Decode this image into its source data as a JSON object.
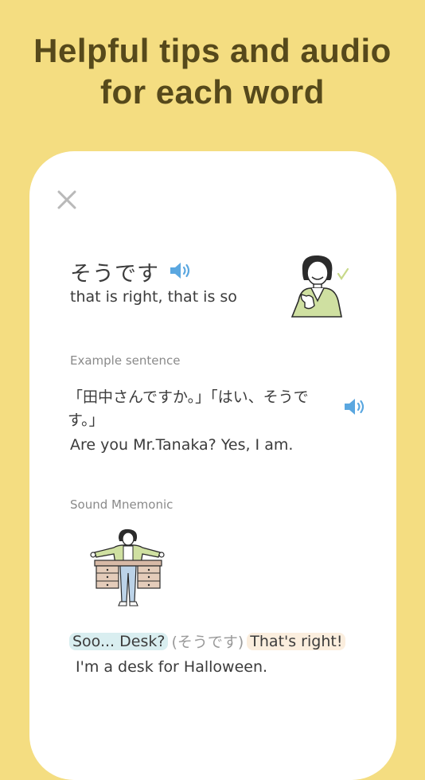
{
  "headline": {
    "line1": "Helpful tips and audio",
    "line2": "for each word"
  },
  "card": {
    "word": "そうです",
    "meaning": "that is right, that is so",
    "example": {
      "label": "Example sentence",
      "japanese": "「田中さんですか。」「はい、そうです。」",
      "english": "Are you Mr.Tanaka? Yes, I am."
    },
    "mnemonic": {
      "label": "Sound Mnemonic",
      "part1": "Soo... Desk?",
      "part2": "(そうです)",
      "part3": "That's right!",
      "sentence": "I'm a desk for Halloween."
    }
  },
  "colors": {
    "background": "#f4dd81",
    "headline": "#56491b",
    "speaker": "#5aa7e0",
    "highlight_blue": "#d9eef0",
    "highlight_peach": "#fbeede"
  },
  "icons": [
    "close-icon",
    "speaker-icon",
    "check-icon"
  ]
}
